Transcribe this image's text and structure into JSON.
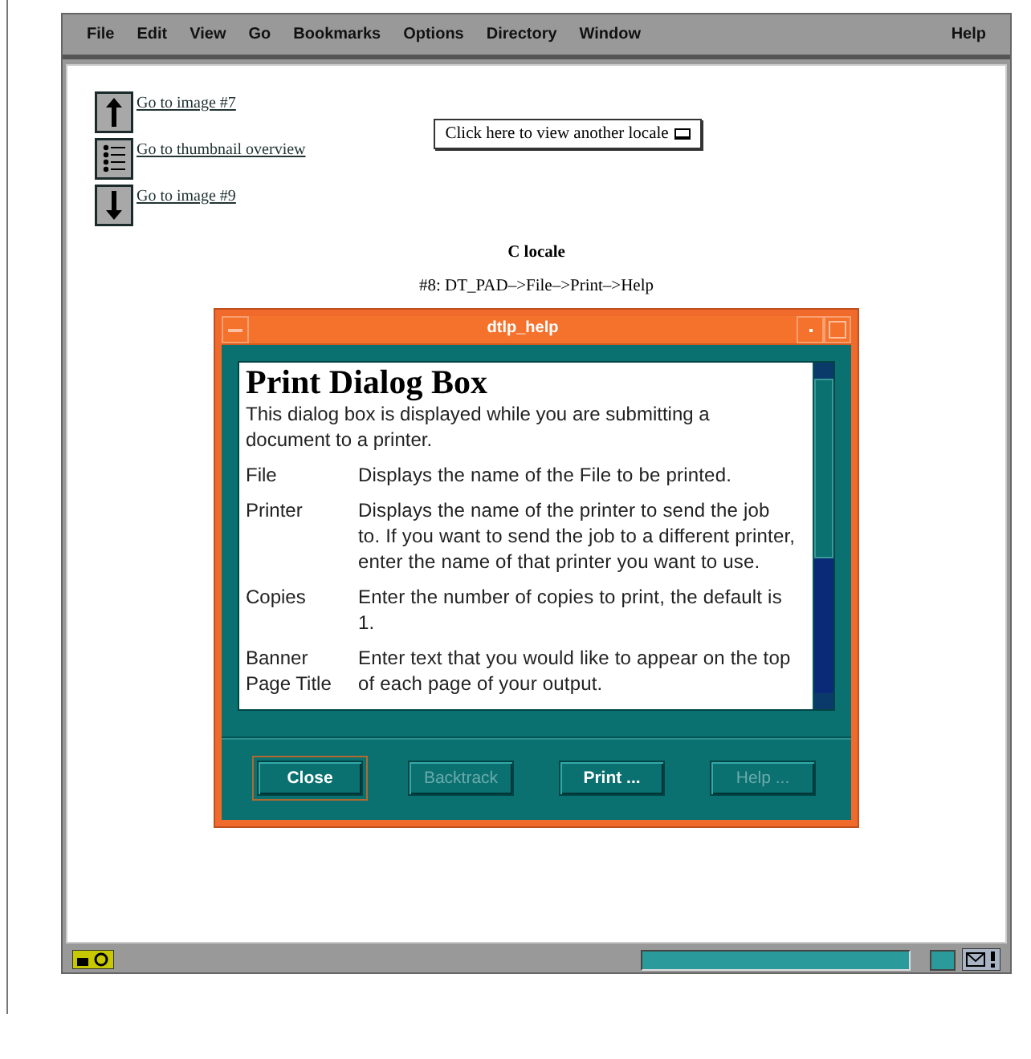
{
  "menu": [
    {
      "label": "File"
    },
    {
      "label": "Edit"
    },
    {
      "label": "View"
    },
    {
      "label": "Go"
    },
    {
      "label": "Bookmarks"
    },
    {
      "label": "Options"
    },
    {
      "label": "Directory"
    },
    {
      "label": "Window"
    }
  ],
  "help_menu": "Help",
  "nav_links": [
    {
      "kind": "up",
      "label": "Go to image #7"
    },
    {
      "kind": "list",
      "label": "Go to thumbnail overview"
    },
    {
      "kind": "down",
      "label": "Go to image #9"
    }
  ],
  "locale_button": "Click here to view another locale",
  "progress": {
    "level": 1
  },
  "heading": "C locale",
  "caption": "#8: DT_PAD–>File–>Print–>Help",
  "dialog": {
    "title": "dtlp_help",
    "help_title": "Print Dialog Box",
    "intro": "This dialog box is displayed while you are submitting a document to a printer.",
    "entries": [
      {
        "term": "File",
        "description": "Displays the name of the File to be printed."
      },
      {
        "term": "Printer",
        "description": "Displays the name of the printer to send the job to. If you want to send the job to a different printer, enter the name of that printer you want to use."
      },
      {
        "term": "Copies",
        "description": "Enter the number of copies to print, the default is 1."
      },
      {
        "term": "Banner Page Title",
        "description": "Enter text that you would like to appear on the top of each page of your output."
      }
    ],
    "buttons": [
      {
        "label": "Close",
        "disabled": false,
        "default": true
      },
      {
        "label": "Backtrack",
        "disabled": true,
        "default": false
      },
      {
        "label": "Print ...",
        "disabled": false,
        "default": false
      },
      {
        "label": "Help ...",
        "disabled": true,
        "default": false
      }
    ]
  }
}
